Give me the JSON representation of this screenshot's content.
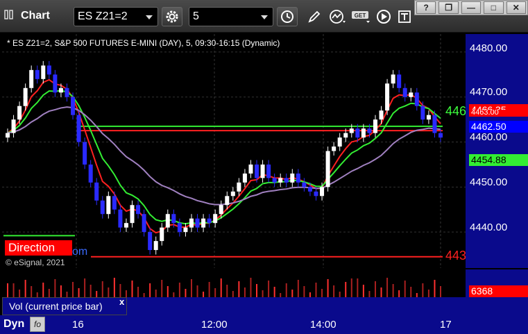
{
  "window": {
    "title": "Chart",
    "controls": [
      "?",
      "❐",
      "—",
      "□",
      "✕"
    ]
  },
  "toolbar": {
    "symbol": "ES Z21=2",
    "interval": "5",
    "icons": [
      "settings-icon",
      "clock-icon",
      "pencil-icon",
      "studies-icon",
      "get-icon",
      "play-icon",
      "text-tool-icon"
    ],
    "get_label": "GET"
  },
  "chart_info": {
    "legend": "* ES Z21=2, S&P 500 FUTURES E-MINI (DAY), 5, 09:30-16:15 (Dynamic)",
    "copyright": "© eSignal, 2021",
    "direction_label": "Direction",
    "direction_suffix": "om",
    "overflow_green": "446",
    "overflow_red": "443"
  },
  "price_axis": {
    "labels": [
      "4480.00",
      "4470.00",
      "4460.00",
      "4450.00",
      "4440.00"
    ],
    "tags": [
      {
        "text": "4466.35",
        "bg": "#ff0000",
        "color": "#ffffff"
      },
      {
        "text": "4463.00",
        "bg": "#ff0000",
        "color": "#ffffff"
      },
      {
        "text": "4462.50",
        "bg": "#0000ff",
        "color": "#ffffff"
      },
      {
        "text": "4454.88",
        "bg": "#33ee33",
        "color": "#000000"
      }
    ]
  },
  "volume": {
    "label": "Vol (current price bar)",
    "close": "x",
    "value_tag": "6368",
    "value_bg": "#ff0000"
  },
  "time_axis": {
    "labels": [
      "16",
      "12:00",
      "14:00",
      "17"
    ],
    "dyn_label": "Dyn"
  },
  "colors": {
    "up_candle": "#ffffff",
    "down_candle": "#2a2aff",
    "ma_red": "#ff2020",
    "ma_green": "#33ee33",
    "ma_purple": "#a080c0",
    "axis_bg": "#0a0a8c"
  },
  "chart_data": {
    "type": "candlestick",
    "title": "ES Z21=2, S&P 500 FUTURES E-MINI (DAY)",
    "ylim": [
      4432,
      4484
    ],
    "y_ticks": [
      4440,
      4450,
      4460,
      4470,
      4480
    ],
    "x_ticks": [
      "16",
      "12:00",
      "14:00",
      "17"
    ],
    "levels": [
      {
        "name": "green horizontal",
        "value": 4463.5
      },
      {
        "name": "red horizontal upper",
        "value": 4463.0
      },
      {
        "name": "red horizontal lower",
        "value": 4434.5
      },
      {
        "name": "green horizontal mid",
        "value": 4454.88
      }
    ],
    "closes": [
      4462,
      4465,
      4468,
      4472,
      4476,
      4474,
      4477,
      4475,
      4471,
      4472,
      4470,
      4466,
      4460,
      4455,
      4451,
      4447,
      4444,
      4448,
      4445,
      4441,
      4442,
      4446,
      4444,
      4440,
      4436,
      4438,
      4441,
      4444,
      4442,
      4440,
      4441,
      4443,
      4441,
      4443,
      4442,
      4444,
      4446,
      4448,
      4449,
      4451,
      4453,
      4455,
      4452,
      4455,
      4452,
      4451,
      4452,
      4451,
      4453,
      4451,
      4450,
      4449,
      4448,
      4450,
      4458,
      4459,
      4461,
      4462,
      4463,
      4461,
      4463,
      4462,
      4465,
      4467,
      4473,
      4475,
      4472,
      4470,
      4471,
      4468,
      4465,
      4466,
      4462,
      4461
    ],
    "volume_last": 6368
  }
}
